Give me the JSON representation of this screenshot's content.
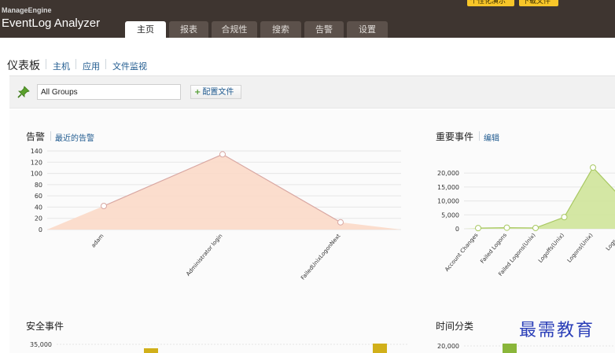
{
  "header": {
    "brand_small": "ManageEngine",
    "brand_main": "EventLog Analyzer",
    "personalize_label": "个性化演示",
    "download_label": "下载文件",
    "tabs": [
      {
        "label": "主页",
        "active": true
      },
      {
        "label": "报表",
        "active": false
      },
      {
        "label": "合规性",
        "active": false
      },
      {
        "label": "搜索",
        "active": false
      },
      {
        "label": "告警",
        "active": false
      },
      {
        "label": "设置",
        "active": false
      }
    ]
  },
  "subnav": {
    "title": "仪表板",
    "links": [
      "主机",
      "应用",
      "文件监视"
    ]
  },
  "toolbar": {
    "group_value": "All Groups",
    "config_label": "配置文件",
    "pin_icon": "pin-icon"
  },
  "alerts_panel": {
    "title": "告警",
    "link": "最近的告警"
  },
  "important_panel": {
    "title": "重要事件",
    "link": "编辑"
  },
  "security_panel": {
    "title": "安全事件"
  },
  "time_panel": {
    "title": "时间分类"
  },
  "watermark": "最需教育",
  "chart_data": [
    {
      "type": "area",
      "categories": [
        "adam",
        "Administrator login",
        "FailedUnixLogonNext"
      ],
      "values": [
        42,
        134,
        13
      ],
      "yticks": [
        0,
        20,
        40,
        60,
        80,
        100,
        120,
        140
      ],
      "ylim": [
        0,
        140
      ],
      "fill": "#fbd9c8",
      "line": "#d8a7a2"
    },
    {
      "type": "area",
      "categories": [
        "Account Changes",
        "Failed Logons",
        "Failed Logons(Unix)",
        "Logoffs(Unix)",
        "Logons(Unix)",
        "Logs (U"
      ],
      "values": [
        250,
        400,
        300,
        4200,
        22000,
        11000
      ],
      "yticks": [
        0,
        5000,
        10000,
        15000,
        20000
      ],
      "ytick_labels": [
        "0",
        "5,000",
        "10,000",
        "15,000",
        "20,000"
      ],
      "ylim": [
        0,
        24000
      ],
      "fill": "#cfe49a",
      "line": "#a8c862"
    },
    {
      "type": "bar",
      "categories": [
        "",
        ""
      ],
      "values": [
        32500,
        35000
      ],
      "yticks": [
        35000
      ],
      "ytick_labels": [
        "35,000"
      ],
      "ylim": [
        0,
        37000
      ],
      "color": "#d1b01a"
    },
    {
      "type": "bar",
      "categories": [
        ""
      ],
      "values": [
        20500
      ],
      "yticks": [
        20000
      ],
      "ytick_labels": [
        "20,000"
      ],
      "ylim": [
        0,
        22000
      ],
      "color": "#8ab63a"
    }
  ]
}
